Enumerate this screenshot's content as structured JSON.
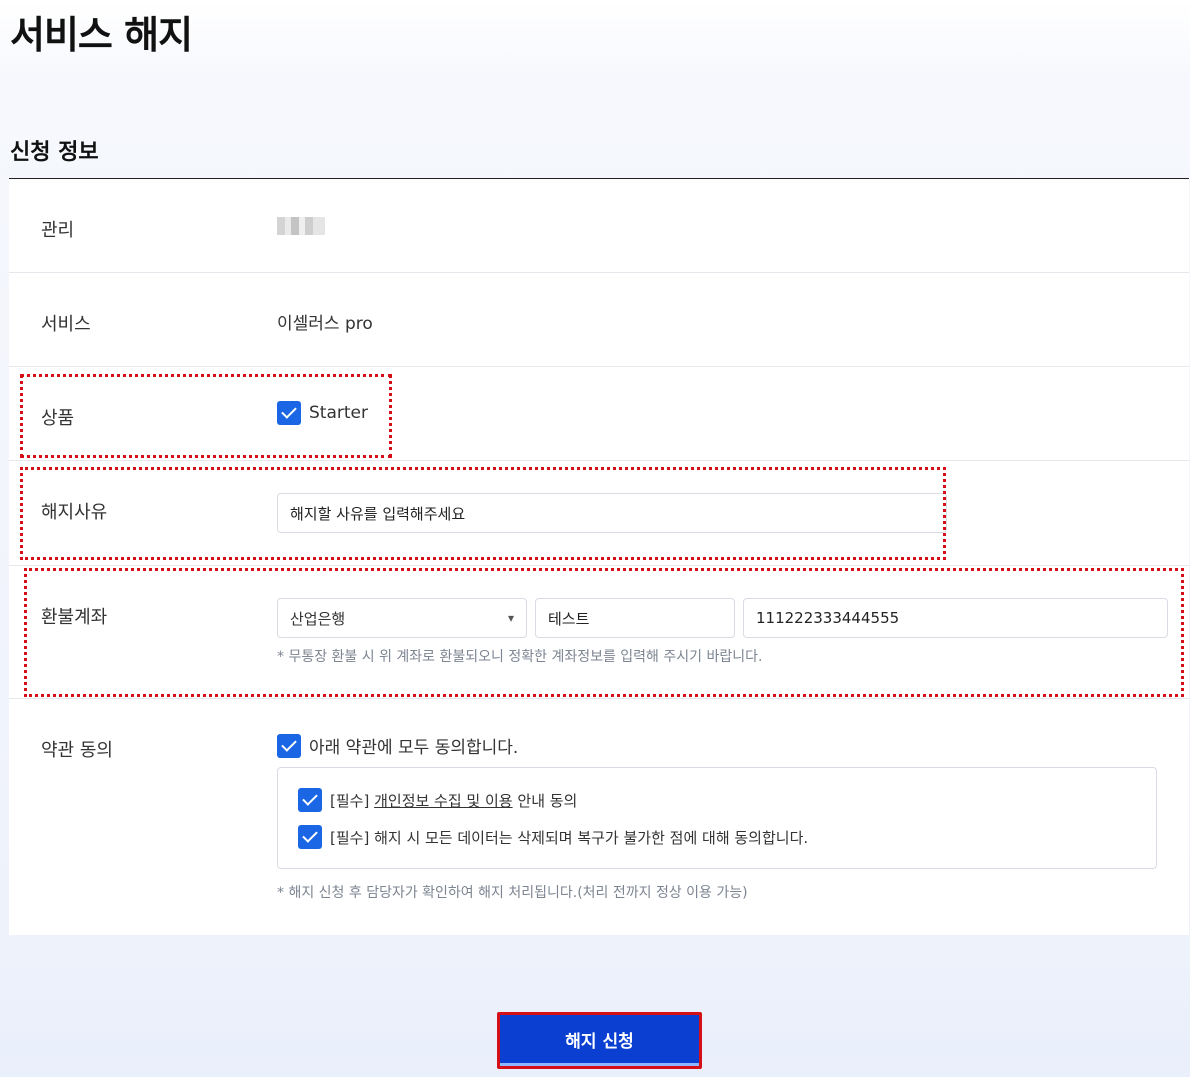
{
  "page": {
    "title": "서비스 해지"
  },
  "section": {
    "title": "신청 정보"
  },
  "rows": {
    "manage": {
      "label": "관리"
    },
    "service": {
      "label": "서비스",
      "value": "이셀러스 pro"
    },
    "product": {
      "label": "상품",
      "option": "Starter",
      "checked": true
    },
    "reason": {
      "label": "해지사유",
      "value": "해지할 사유를 입력해주세요"
    },
    "refund": {
      "label": "환불계좌",
      "bank": "산업은행",
      "holder": "테스트",
      "account": "111222333444555",
      "hint": "* 무통장 환불 시 위 계좌로 환불되오니 정확한 계좌정보를 입력해 주시기 바랍니다."
    },
    "terms": {
      "label": "약관 동의",
      "all": "아래 약관에 모두 동의합니다.",
      "item1_prefix": "[필수]",
      "item1_link": "개인정보 수집 및 이용",
      "item1_suffix": "안내 동의",
      "item2": "[필수] 해지 시 모든 데이터는 삭제되며 복구가 불가한 점에 대해 동의합니다.",
      "note": "* 해지 신청 후 담당자가 확인하여 해지 처리됩니다.(처리 전까지 정상 이용 가능)"
    }
  },
  "submit": {
    "label": "해지 신청"
  },
  "colors": {
    "accent": "#1a66e5",
    "button": "#0a3fd2",
    "highlight": "#d50f18"
  },
  "icons": [
    "checkbox-checked-icon",
    "chevron-down-icon"
  ]
}
